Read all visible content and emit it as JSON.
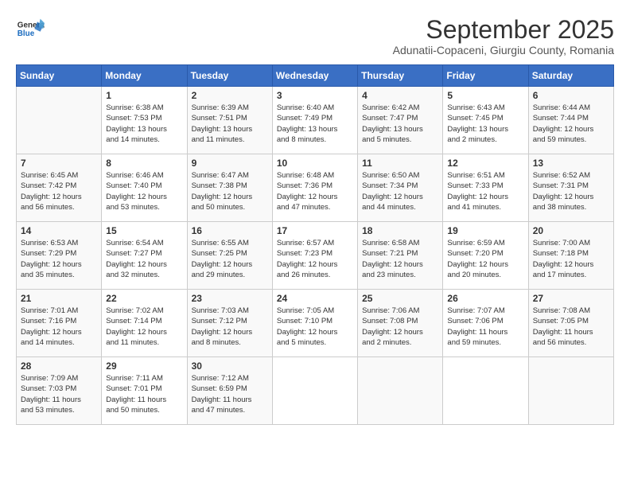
{
  "logo": {
    "line1": "General",
    "line2": "Blue"
  },
  "title": "September 2025",
  "subtitle": "Adunatii-Copaceni, Giurgiu County, Romania",
  "days_header": [
    "Sunday",
    "Monday",
    "Tuesday",
    "Wednesday",
    "Thursday",
    "Friday",
    "Saturday"
  ],
  "weeks": [
    [
      {
        "day": "",
        "info": ""
      },
      {
        "day": "1",
        "info": "Sunrise: 6:38 AM\nSunset: 7:53 PM\nDaylight: 13 hours\nand 14 minutes."
      },
      {
        "day": "2",
        "info": "Sunrise: 6:39 AM\nSunset: 7:51 PM\nDaylight: 13 hours\nand 11 minutes."
      },
      {
        "day": "3",
        "info": "Sunrise: 6:40 AM\nSunset: 7:49 PM\nDaylight: 13 hours\nand 8 minutes."
      },
      {
        "day": "4",
        "info": "Sunrise: 6:42 AM\nSunset: 7:47 PM\nDaylight: 13 hours\nand 5 minutes."
      },
      {
        "day": "5",
        "info": "Sunrise: 6:43 AM\nSunset: 7:45 PM\nDaylight: 13 hours\nand 2 minutes."
      },
      {
        "day": "6",
        "info": "Sunrise: 6:44 AM\nSunset: 7:44 PM\nDaylight: 12 hours\nand 59 minutes."
      }
    ],
    [
      {
        "day": "7",
        "info": "Sunrise: 6:45 AM\nSunset: 7:42 PM\nDaylight: 12 hours\nand 56 minutes."
      },
      {
        "day": "8",
        "info": "Sunrise: 6:46 AM\nSunset: 7:40 PM\nDaylight: 12 hours\nand 53 minutes."
      },
      {
        "day": "9",
        "info": "Sunrise: 6:47 AM\nSunset: 7:38 PM\nDaylight: 12 hours\nand 50 minutes."
      },
      {
        "day": "10",
        "info": "Sunrise: 6:48 AM\nSunset: 7:36 PM\nDaylight: 12 hours\nand 47 minutes."
      },
      {
        "day": "11",
        "info": "Sunrise: 6:50 AM\nSunset: 7:34 PM\nDaylight: 12 hours\nand 44 minutes."
      },
      {
        "day": "12",
        "info": "Sunrise: 6:51 AM\nSunset: 7:33 PM\nDaylight: 12 hours\nand 41 minutes."
      },
      {
        "day": "13",
        "info": "Sunrise: 6:52 AM\nSunset: 7:31 PM\nDaylight: 12 hours\nand 38 minutes."
      }
    ],
    [
      {
        "day": "14",
        "info": "Sunrise: 6:53 AM\nSunset: 7:29 PM\nDaylight: 12 hours\nand 35 minutes."
      },
      {
        "day": "15",
        "info": "Sunrise: 6:54 AM\nSunset: 7:27 PM\nDaylight: 12 hours\nand 32 minutes."
      },
      {
        "day": "16",
        "info": "Sunrise: 6:55 AM\nSunset: 7:25 PM\nDaylight: 12 hours\nand 29 minutes."
      },
      {
        "day": "17",
        "info": "Sunrise: 6:57 AM\nSunset: 7:23 PM\nDaylight: 12 hours\nand 26 minutes."
      },
      {
        "day": "18",
        "info": "Sunrise: 6:58 AM\nSunset: 7:21 PM\nDaylight: 12 hours\nand 23 minutes."
      },
      {
        "day": "19",
        "info": "Sunrise: 6:59 AM\nSunset: 7:20 PM\nDaylight: 12 hours\nand 20 minutes."
      },
      {
        "day": "20",
        "info": "Sunrise: 7:00 AM\nSunset: 7:18 PM\nDaylight: 12 hours\nand 17 minutes."
      }
    ],
    [
      {
        "day": "21",
        "info": "Sunrise: 7:01 AM\nSunset: 7:16 PM\nDaylight: 12 hours\nand 14 minutes."
      },
      {
        "day": "22",
        "info": "Sunrise: 7:02 AM\nSunset: 7:14 PM\nDaylight: 12 hours\nand 11 minutes."
      },
      {
        "day": "23",
        "info": "Sunrise: 7:03 AM\nSunset: 7:12 PM\nDaylight: 12 hours\nand 8 minutes."
      },
      {
        "day": "24",
        "info": "Sunrise: 7:05 AM\nSunset: 7:10 PM\nDaylight: 12 hours\nand 5 minutes."
      },
      {
        "day": "25",
        "info": "Sunrise: 7:06 AM\nSunset: 7:08 PM\nDaylight: 12 hours\nand 2 minutes."
      },
      {
        "day": "26",
        "info": "Sunrise: 7:07 AM\nSunset: 7:06 PM\nDaylight: 11 hours\nand 59 minutes."
      },
      {
        "day": "27",
        "info": "Sunrise: 7:08 AM\nSunset: 7:05 PM\nDaylight: 11 hours\nand 56 minutes."
      }
    ],
    [
      {
        "day": "28",
        "info": "Sunrise: 7:09 AM\nSunset: 7:03 PM\nDaylight: 11 hours\nand 53 minutes."
      },
      {
        "day": "29",
        "info": "Sunrise: 7:11 AM\nSunset: 7:01 PM\nDaylight: 11 hours\nand 50 minutes."
      },
      {
        "day": "30",
        "info": "Sunrise: 7:12 AM\nSunset: 6:59 PM\nDaylight: 11 hours\nand 47 minutes."
      },
      {
        "day": "",
        "info": ""
      },
      {
        "day": "",
        "info": ""
      },
      {
        "day": "",
        "info": ""
      },
      {
        "day": "",
        "info": ""
      }
    ]
  ]
}
